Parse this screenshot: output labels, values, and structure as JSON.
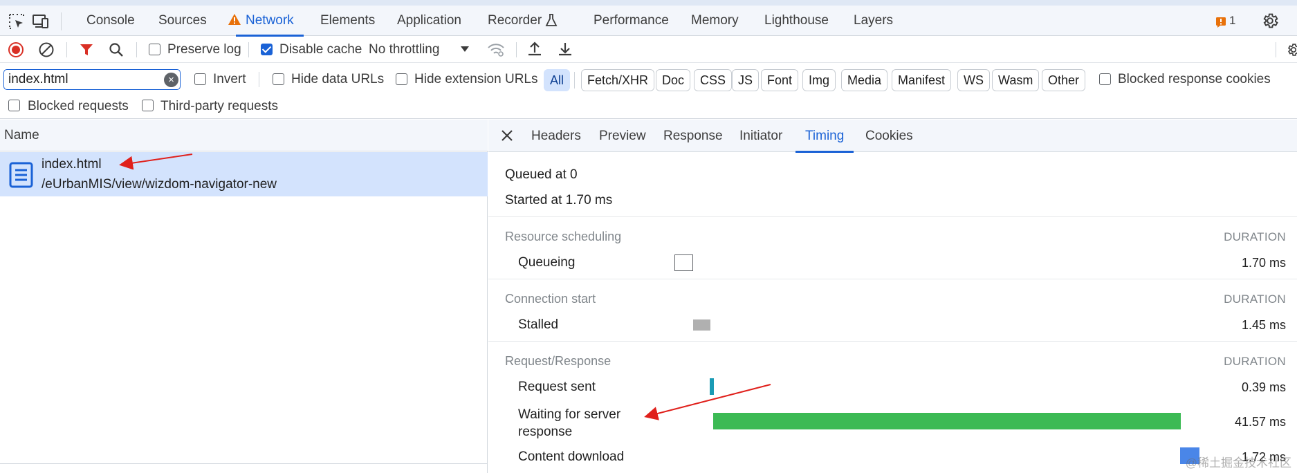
{
  "tabs": {
    "items": [
      "Console",
      "Sources",
      "Network",
      "Elements",
      "Application",
      "Recorder",
      "Performance",
      "Memory",
      "Lighthouse",
      "Layers"
    ],
    "active": "Network",
    "issues_count": "1"
  },
  "toolbar": {
    "preserve_log": "Preserve log",
    "disable_cache": "Disable cache",
    "throttling": "No throttling"
  },
  "filter": {
    "value": "index.html",
    "invert": "Invert",
    "hide_data_urls": "Hide data URLs",
    "hide_extension_urls": "Hide extension URLs",
    "types": [
      "All",
      "Fetch/XHR",
      "Doc",
      "CSS",
      "JS",
      "Font",
      "Img",
      "Media",
      "Manifest",
      "WS",
      "Wasm",
      "Other"
    ],
    "blocked_response_cookies": "Blocked response cookies",
    "blocked_requests": "Blocked requests",
    "third_party_requests": "Third-party requests"
  },
  "requests": {
    "column": "Name",
    "rows": [
      {
        "name": "index.html",
        "path": "/eUrbanMIS/view/wizdom-navigator-new"
      }
    ]
  },
  "details": {
    "tabs": [
      "Headers",
      "Preview",
      "Response",
      "Initiator",
      "Timing",
      "Cookies"
    ],
    "active": "Timing",
    "queued_at": "Queued at 0",
    "started_at": "Started at 1.70 ms",
    "duration_label": "DURATION",
    "sections": [
      {
        "title": "Resource scheduling",
        "rows": [
          {
            "label": "Queueing",
            "duration": "1.70 ms",
            "color": "#ffffff"
          }
        ]
      },
      {
        "title": "Connection start",
        "rows": [
          {
            "label": "Stalled",
            "duration": "1.45 ms",
            "color": "#b0b0b0"
          }
        ]
      },
      {
        "title": "Request/Response",
        "rows": [
          {
            "label": "Request sent",
            "duration": "0.39 ms",
            "color": "#1a9bb5"
          },
          {
            "label": "Waiting for server response",
            "duration": "41.57 ms",
            "color": "#3cba54"
          },
          {
            "label": "Content download",
            "duration": "1.72 ms",
            "color": "#4a86e8"
          }
        ]
      }
    ]
  },
  "watermark": "@稀土掘金技术社区"
}
